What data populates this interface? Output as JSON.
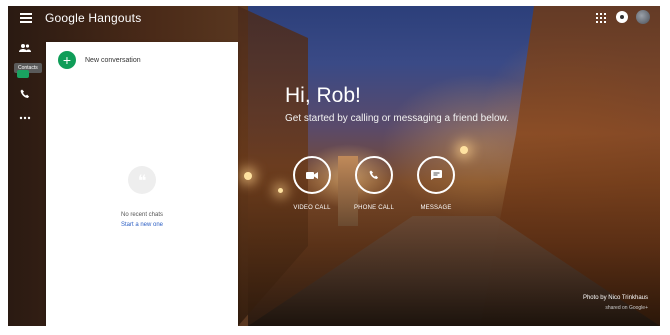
{
  "topbar": {
    "brand": "Google Hangouts"
  },
  "rail": {
    "contacts_tooltip": "Contacts"
  },
  "panel": {
    "new_conversation": "New conversation",
    "empty_text": "No recent chats",
    "start_link": "Start a new one"
  },
  "main": {
    "greeting": "Hi, Rob!",
    "subtitle": "Get started by calling or messaging a friend below.",
    "actions": [
      {
        "label": "VIDEO CALL",
        "icon": "video-icon"
      },
      {
        "label": "PHONE CALL",
        "icon": "phone-icon"
      },
      {
        "label": "MESSAGE",
        "icon": "message-icon"
      }
    ]
  },
  "credit": {
    "photo_by": "Photo by Nico Trinkhaus",
    "shared_on": "shared on Google+"
  },
  "colors": {
    "accent_green": "#0f9d58",
    "link_blue": "#2c5fc4"
  }
}
